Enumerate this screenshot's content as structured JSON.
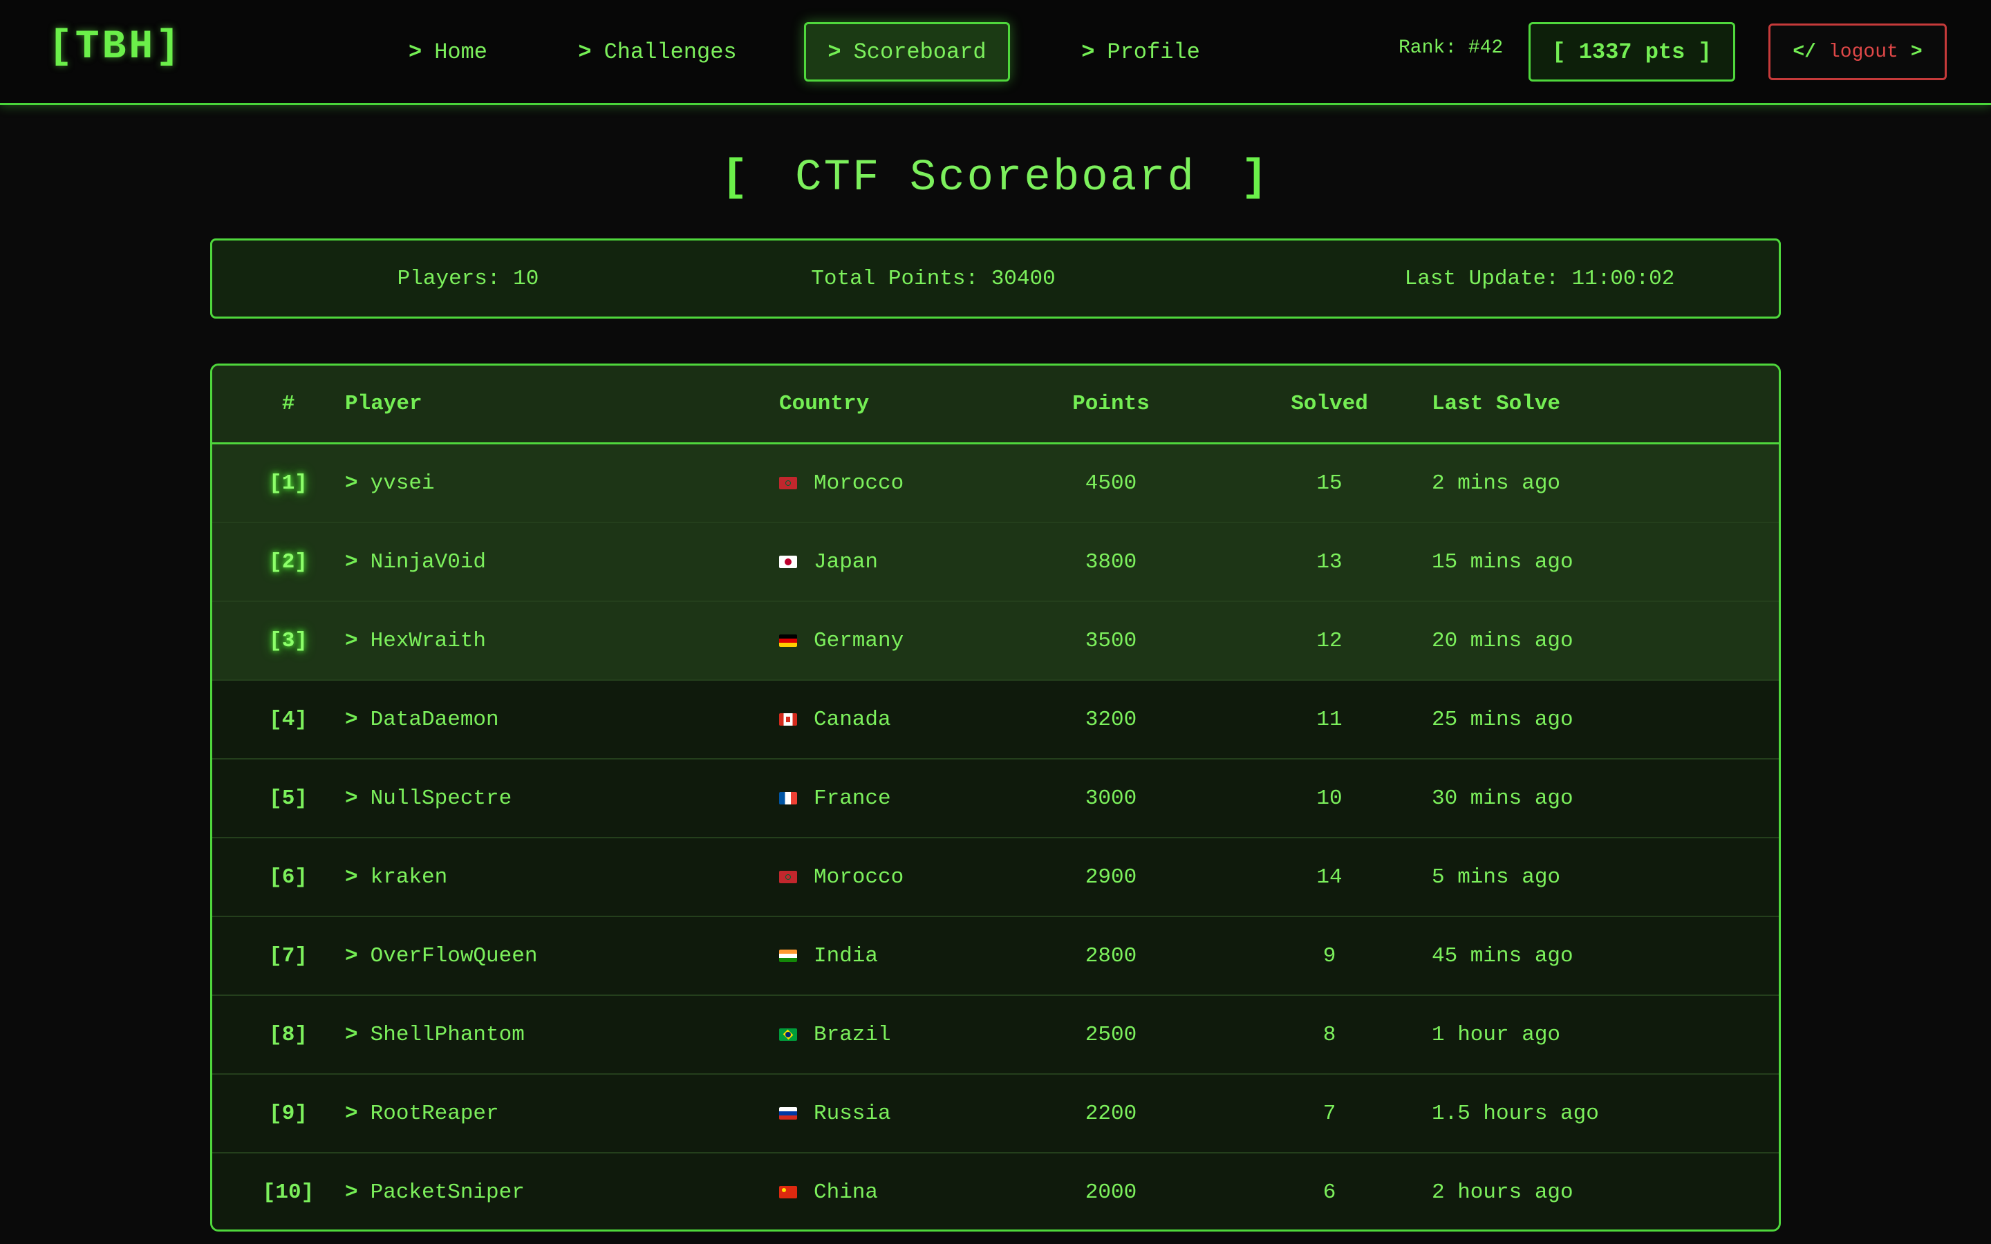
{
  "header": {
    "logo": "[TBH]",
    "nav": [
      {
        "arrow": ">",
        "label": "Home"
      },
      {
        "arrow": ">",
        "label": "Challenges"
      },
      {
        "arrow": ">",
        "label": "Scoreboard",
        "active": true
      },
      {
        "arrow": ">",
        "label": "Profile"
      }
    ],
    "rank": "Rank: #42",
    "points": "[ 1337 pts ]",
    "logout": {
      "open": "</",
      "label": "logout",
      "close": ">"
    }
  },
  "page": {
    "title_open": "[",
    "title": "CTF Scoreboard",
    "title_close": "]"
  },
  "stats": {
    "players": "Players: 10",
    "total_points": "Total Points: 30400",
    "last_update": "Last Update: 11:00:02"
  },
  "table": {
    "columns": [
      "#",
      "Player",
      "Country",
      "Points",
      "Solved",
      "Last Solve"
    ],
    "rows": [
      {
        "rank": "[1]",
        "player": "yvsei",
        "country": "Morocco",
        "flag": "morocco-flag-icon",
        "points": "4500",
        "solved": "15",
        "last": "2 mins ago"
      },
      {
        "rank": "[2]",
        "player": "NinjaV0id",
        "country": "Japan",
        "flag": "japan-flag-icon",
        "points": "3800",
        "solved": "13",
        "last": "15 mins ago"
      },
      {
        "rank": "[3]",
        "player": "HexWraith",
        "country": "Germany",
        "flag": "germany-flag-icon",
        "points": "3500",
        "solved": "12",
        "last": "20 mins ago"
      },
      {
        "rank": "[4]",
        "player": "DataDaemon",
        "country": "Canada",
        "flag": "canada-flag-icon",
        "points": "3200",
        "solved": "11",
        "last": "25 mins ago"
      },
      {
        "rank": "[5]",
        "player": "NullSpectre",
        "country": "France",
        "flag": "france-flag-icon",
        "points": "3000",
        "solved": "10",
        "last": "30 mins ago"
      },
      {
        "rank": "[6]",
        "player": "kraken",
        "country": "Morocco",
        "flag": "morocco-flag-icon",
        "points": "2900",
        "solved": "14",
        "last": "5 mins ago"
      },
      {
        "rank": "[7]",
        "player": "OverFlowQueen",
        "country": "India",
        "flag": "india-flag-icon",
        "points": "2800",
        "solved": "9",
        "last": "45 mins ago"
      },
      {
        "rank": "[8]",
        "player": "ShellPhantom",
        "country": "Brazil",
        "flag": "brazil-flag-icon",
        "points": "2500",
        "solved": "8",
        "last": "1 hour ago"
      },
      {
        "rank": "[9]",
        "player": "RootReaper",
        "country": "Russia",
        "flag": "russia-flag-icon",
        "points": "2200",
        "solved": "7",
        "last": "1.5 hours ago"
      },
      {
        "rank": "[10]",
        "player": "PacketSniper",
        "country": "China",
        "flag": "china-flag-icon",
        "points": "2000",
        "solved": "6",
        "last": "2 hours ago"
      }
    ]
  },
  "colors": {
    "accent": "#4fd73c",
    "text": "#7cf05c",
    "background": "#0a0a0a",
    "danger": "#e04848"
  }
}
